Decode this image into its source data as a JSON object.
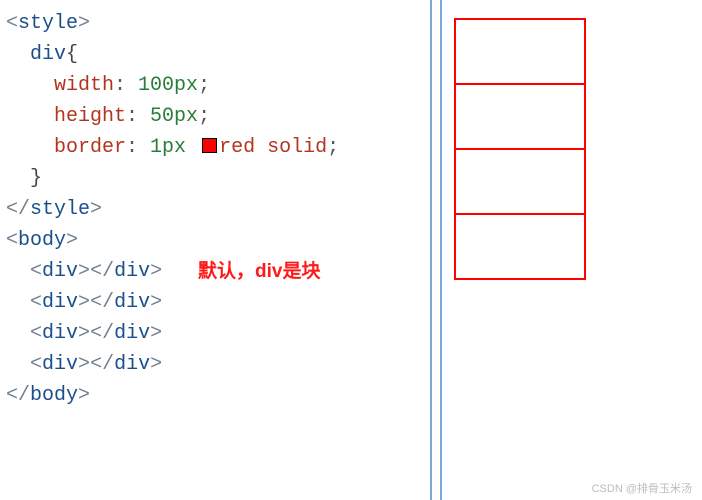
{
  "code": {
    "l1_open_angle": "<",
    "l1_tag": "style",
    "l1_close_angle": ">",
    "l2_indent": "  ",
    "l2_selector": "div",
    "l2_brace": "{",
    "l3_indent": "    ",
    "l3_prop": "width",
    "l3_colon": ": ",
    "l3_val": "100px",
    "l3_semi": ";",
    "l4_indent": "    ",
    "l4_prop": "height",
    "l4_colon": ": ",
    "l4_val": "50px",
    "l4_semi": ";",
    "l5_indent": "    ",
    "l5_prop": "border",
    "l5_colon": ": ",
    "l5_val1": "1px",
    "l5_val2": "red",
    "l5_val3": " solid",
    "l5_semi": ";",
    "l6_indent": "  ",
    "l6_brace": "}",
    "l7_open_angle": "</",
    "l7_tag": "style",
    "l7_close_angle": ">",
    "l8_open_angle": "<",
    "l8_tag": "body",
    "l8_close_angle": ">",
    "div_indent": "  ",
    "div_open_a": "<",
    "div_open_t": "div",
    "div_open_c": ">",
    "div_close_a": "</",
    "div_close_t": "div",
    "div_close_c": ">",
    "l13_open_angle": "</",
    "l13_tag": "body",
    "l13_close_angle": ">"
  },
  "annotation": "默认，div是块",
  "watermark": "CSDN @排骨玉米汤",
  "render": {
    "box_count": 4
  }
}
